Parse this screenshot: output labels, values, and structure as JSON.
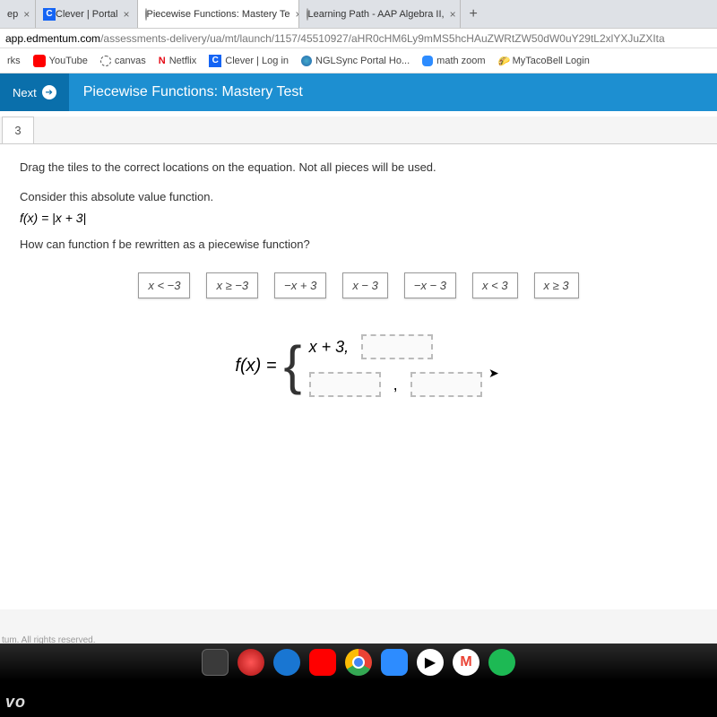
{
  "tabs": {
    "t0": {
      "close": "×"
    },
    "t1": {
      "label": "Clever | Portal",
      "close": "×"
    },
    "t2": {
      "label": "Piecewise Functions: Mastery Te",
      "close": "×"
    },
    "t3": {
      "label": "Learning Path - AAP Algebra II,",
      "close": "×"
    },
    "plus": "+"
  },
  "url": {
    "domain": "app.edmentum.com",
    "path": "/assessments-delivery/ua/mt/launch/1157/45510927/aHR0cHM6Ly9mMS5hcHAuZWRtZW50dW0uY29tL2xlYXJuZXIta"
  },
  "bookmarks": {
    "b0": "rks",
    "b1": "YouTube",
    "b2": "canvas",
    "b3": "Netflix",
    "b4": "Clever | Log in",
    "b5": "NGLSync Portal Ho...",
    "b6": "math zoom",
    "b7": "MyTacoBell Login"
  },
  "header": {
    "next": "Next",
    "arrow": "➔",
    "title": "Piecewise Functions: Mastery Test"
  },
  "question": {
    "number": "3",
    "instruction": "Drag the tiles to the correct locations on the equation. Not all pieces will be used.",
    "sub1": "Consider this absolute value function.",
    "fx_def": "f(x) = |x + 3|",
    "sub2": "How can function f be rewritten as a piecewise function?",
    "tiles": {
      "t0": "x < −3",
      "t1": "x ≥ −3",
      "t2": "−x + 3",
      "t3": "x − 3",
      "t4": "−x − 3",
      "t5": "x < 3",
      "t6": "x ≥ 3"
    },
    "fx_label": "f(x) =",
    "piece_top": "x + 3,",
    "comma": ","
  },
  "footer": "tum. All rights reserved.",
  "vo": "vo"
}
